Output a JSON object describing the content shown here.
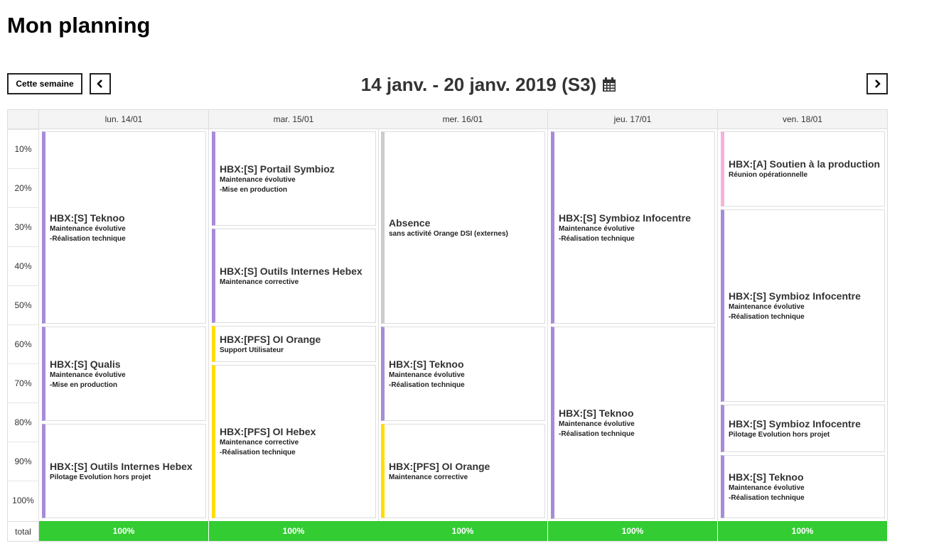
{
  "page": {
    "title": "Mon planning",
    "this_week_label": "Cette semaine",
    "week_range": "14 janv. - 20 janv. 2019 (S3)",
    "prev_icon": "chevron-left-icon",
    "next_icon": "chevron-right-icon",
    "calendar_icon": "calendar-icon"
  },
  "days": [
    {
      "label": "lun. 14/01"
    },
    {
      "label": "mar. 15/01"
    },
    {
      "label": "mer. 16/01"
    },
    {
      "label": "jeu. 17/01"
    },
    {
      "label": "ven. 18/01"
    }
  ],
  "rows": [
    "10%",
    "20%",
    "30%",
    "40%",
    "50%",
    "60%",
    "70%",
    "80%",
    "90%",
    "100%"
  ],
  "total": {
    "label": "total",
    "values": [
      "100%",
      "100%",
      "100%",
      "100%",
      "100%"
    ],
    "color": "#33cc33"
  },
  "colors": {
    "purple": "#a88bd8",
    "yellow": "#ffdd00",
    "grey": "#cccccc",
    "pink": "#f5b3d9"
  },
  "events": [
    [
      {
        "title": "HBX:[S] Teknoo",
        "subtitle": "Maintenance évolutive",
        "detail": "-Réalisation technique",
        "color": "purple",
        "share": 0.5
      },
      {
        "title": "HBX:[S] Qualis",
        "subtitle": "Maintenance évolutive",
        "detail": "-Mise en production",
        "color": "purple",
        "share": 0.25
      },
      {
        "title": "HBX:[S] Outils Internes Hebex",
        "subtitle": "Pilotage Evolution hors projet",
        "detail": "",
        "color": "purple",
        "share": 0.25
      }
    ],
    [
      {
        "title": "HBX:[S] Portail Symbioz",
        "subtitle": "Maintenance évolutive",
        "detail": "-Mise en production",
        "color": "purple",
        "share": 0.25
      },
      {
        "title": "HBX:[S] Outils Internes Hebex",
        "subtitle": "Maintenance corrective",
        "detail": "",
        "color": "purple",
        "share": 0.25
      },
      {
        "title": "HBX:[PFS] OI Orange",
        "subtitle": "Support Utilisateur",
        "detail": "",
        "color": "yellow",
        "share": 0.1
      },
      {
        "title": "HBX:[PFS] OI Hebex",
        "subtitle": "Maintenance corrective",
        "detail": "-Réalisation technique",
        "color": "yellow",
        "share": 0.4
      }
    ],
    [
      {
        "title": "Absence",
        "subtitle": "sans activité Orange DSI (externes)",
        "detail": "",
        "color": "grey",
        "share": 0.5
      },
      {
        "title": "HBX:[S] Teknoo",
        "subtitle": "Maintenance évolutive",
        "detail": "-Réalisation technique",
        "color": "purple",
        "share": 0.25
      },
      {
        "title": "HBX:[PFS] OI Orange",
        "subtitle": "Maintenance corrective",
        "detail": "",
        "color": "yellow",
        "share": 0.25
      }
    ],
    [
      {
        "title": "HBX:[S] Symbioz Infocentre",
        "subtitle": "Maintenance évolutive",
        "detail": "-Réalisation technique",
        "color": "purple",
        "share": 0.5
      },
      {
        "title": "HBX:[S] Teknoo",
        "subtitle": "Maintenance évolutive",
        "detail": "-Réalisation technique",
        "color": "purple",
        "share": 0.5
      }
    ],
    [
      {
        "title": "HBX:[A] Soutien à la production",
        "subtitle": "Réunion opérationnelle",
        "detail": "",
        "color": "pink",
        "share": 0.2
      },
      {
        "title": "HBX:[S] Symbioz Infocentre",
        "subtitle": "Maintenance évolutive",
        "detail": "-Réalisation technique",
        "color": "purple",
        "share": 0.5
      },
      {
        "title": "HBX:[S] Symbioz Infocentre",
        "subtitle": "Pilotage Evolution hors projet",
        "detail": "",
        "color": "purple",
        "share": 0.13
      },
      {
        "title": "HBX:[S] Teknoo",
        "subtitle": "Maintenance évolutive",
        "detail": "-Réalisation technique",
        "color": "purple",
        "share": 0.17
      }
    ]
  ]
}
